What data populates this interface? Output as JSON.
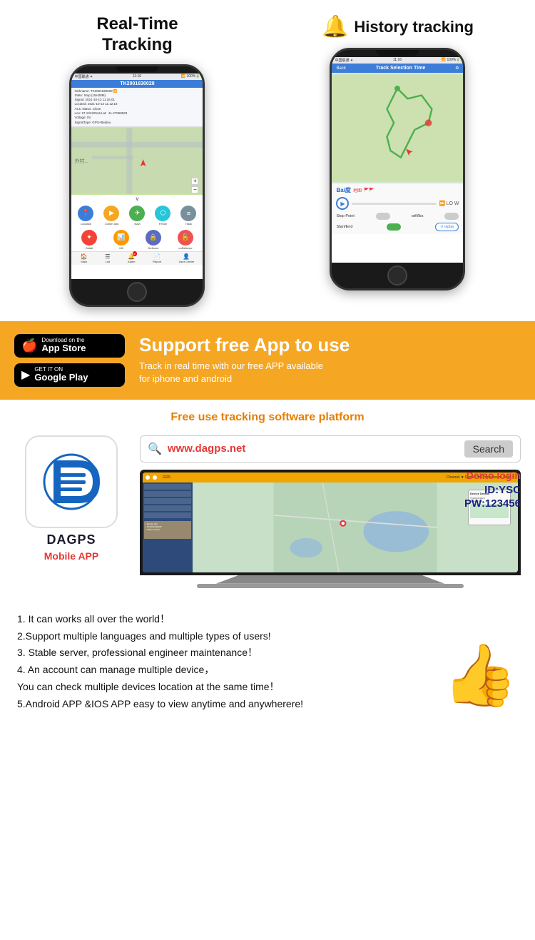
{
  "header": {
    "realtime_title_line1": "Real-Time",
    "realtime_title_line2": "Tracking",
    "history_title": "History tracking"
  },
  "phone_left": {
    "status_bar": "中国联通  11:16",
    "tracker_id": "TK2001630028",
    "info": [
      "Nickname: TK2001630028",
      "State: Stop (15H28M)",
      "Signal: 2021-10-13 11:16:01",
      "Located: 2021-10-13 11:12:18",
      "ACC status: Close",
      "Lon: 27.13122944,Lat:",
      "-11.27069833",
      "Voltage: 0V",
      "SignalType: GPS+Beidou"
    ],
    "buttons": [
      {
        "label": "Location",
        "color": "#3b7dd8"
      },
      {
        "label": "Command",
        "color": "#f5a623"
      },
      {
        "label": "Navi",
        "color": "#4caf50"
      },
      {
        "label": "Fence",
        "color": "#26c6da"
      },
      {
        "label": "Track",
        "color": "#78909c"
      }
    ],
    "buttons2": [
      {
        "label": "Detail",
        "color": "#f44336"
      },
      {
        "label": "Mil",
        "color": "#ff9800"
      },
      {
        "label": "Defence",
        "color": "#5c6bc0"
      },
      {
        "label": "unDefence",
        "color": "#ef5350"
      }
    ],
    "nav": [
      "Main",
      "List",
      "Alarm",
      "Report",
      "User Center"
    ]
  },
  "phone_right": {
    "back_label": "Back",
    "title": "Track Selection Time",
    "stop_point_label": "Stop Point",
    "wifi_lbs_label": "wifi/lbs",
    "start_end_label": "Start/End",
    "replay_label": "replay",
    "lo_w_label": "LO W"
  },
  "banner": {
    "app_store_small": "Download on the",
    "app_store_large": "App Store",
    "google_play_small": "GET IT ON",
    "google_play_large": "Google Play",
    "headline": "Support free App to use",
    "subtext": "Track in real time with our free APP available\nfor iphone and android"
  },
  "platform": {
    "title": "Free use tracking software platform",
    "logo_name": "DAGPS",
    "mobile_app_label": "Mobile APP",
    "search_url": "www.dagps.net",
    "search_btn": "Search",
    "demo_login": "Demo login",
    "demo_id": "ID:YSC",
    "demo_pw": "PW:123456"
  },
  "features": {
    "items": [
      "1. It can works all over the world！",
      "2.Support multiple languages and multiple types of users!",
      "3. Stable server, professional engineer maintenance！",
      "4. An account can manage multiple device，",
      "You can check multiple devices location at the same time！",
      "5.Android APP &IOS APP easy to view anytime and anywherere!"
    ]
  }
}
